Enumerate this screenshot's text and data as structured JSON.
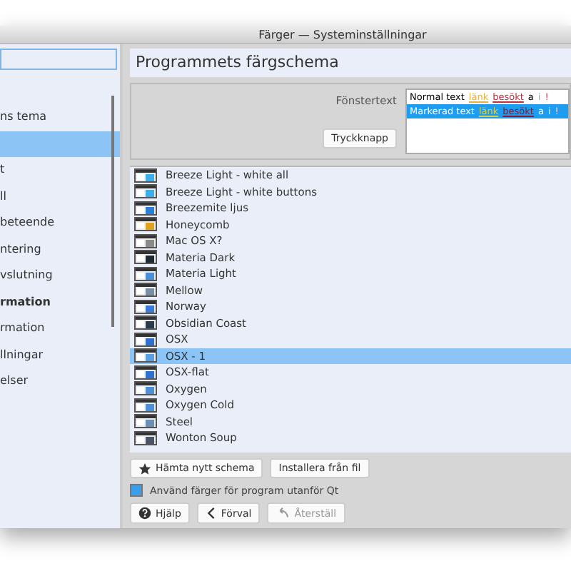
{
  "window": {
    "title": "Färger — Systeminställningar"
  },
  "sidebar": {
    "items": [
      {
        "label": "ns tema",
        "selected": false,
        "kind": "item"
      },
      {
        "selected": true,
        "kind": "item"
      },
      {
        "label": "t",
        "selected": false,
        "kind": "item"
      },
      {
        "label": "ll",
        "selected": false,
        "kind": "item"
      },
      {
        "label": "beteende",
        "selected": false,
        "kind": "item"
      },
      {
        "label": "ntering",
        "selected": false,
        "kind": "item"
      },
      {
        "label": "vslutning",
        "selected": false,
        "kind": "item"
      },
      {
        "label": "rmation",
        "kind": "header"
      },
      {
        "label": "rmation",
        "selected": false,
        "kind": "item"
      },
      {
        "label": "llningar",
        "selected": false,
        "kind": "item"
      },
      {
        "label": "elser",
        "selected": false,
        "kind": "item"
      }
    ]
  },
  "header": "Programmets färgschema",
  "preview": {
    "label": "Fönstertext",
    "button": "Tryckknapp",
    "rows": [
      {
        "selected": false,
        "parts": [
          {
            "kind": "normal",
            "text": "Normal text"
          },
          {
            "kind": "link",
            "text": "länk"
          },
          {
            "kind": "visited",
            "text": "besökt"
          },
          {
            "kind": "normal",
            "text": "a"
          },
          {
            "kind": "inactive",
            "text": "i"
          },
          {
            "kind": "alert",
            "text": "!"
          }
        ]
      },
      {
        "selected": true,
        "parts": [
          {
            "kind": "normal",
            "text": "Markerad text"
          },
          {
            "kind": "link",
            "text": "länk"
          },
          {
            "kind": "visited",
            "text": "besökt"
          },
          {
            "kind": "normal",
            "text": "a"
          },
          {
            "kind": "inactive",
            "text": "i"
          },
          {
            "kind": "alert",
            "text": "!"
          }
        ]
      }
    ]
  },
  "schemes": [
    {
      "name": "Breeze Light - white all",
      "selected": false,
      "color": "#3daee9"
    },
    {
      "name": "Breeze Light - white buttons",
      "selected": false,
      "color": "#3daee9"
    },
    {
      "name": "Breezemite ljus",
      "selected": false,
      "color": "#2c7fd6"
    },
    {
      "name": "Honeycomb",
      "selected": false,
      "color": "#e0a21c"
    },
    {
      "name": "Mac OS X?",
      "selected": false,
      "color": "#8a8a8a"
    },
    {
      "name": "Materia Dark",
      "selected": false,
      "color": "#1e2a33"
    },
    {
      "name": "Materia Light",
      "selected": false,
      "color": "#4a90d9"
    },
    {
      "name": "Mellow",
      "selected": false,
      "color": "#7a8fa6"
    },
    {
      "name": "Norway",
      "selected": false,
      "color": "#3a7bd5"
    },
    {
      "name": "Obsidian Coast",
      "selected": false,
      "color": "#2b3a4a"
    },
    {
      "name": "OSX",
      "selected": false,
      "color": "#2f6fd0"
    },
    {
      "name": "OSX - 1",
      "selected": true,
      "color": "#5aa0e0"
    },
    {
      "name": "OSX-flat",
      "selected": false,
      "color": "#2f6fd0"
    },
    {
      "name": "Oxygen",
      "selected": false,
      "color": "#4f8fd8"
    },
    {
      "name": "Oxygen Cold",
      "selected": false,
      "color": "#4f8fd8"
    },
    {
      "name": "Steel",
      "selected": false,
      "color": "#6b8fb5"
    },
    {
      "name": "Wonton Soup",
      "selected": false,
      "color": "#4a5566"
    }
  ],
  "actions": [
    "Hämta nytt schema",
    "Installera från fil"
  ],
  "apply_outside_qt": {
    "label": "Använd färger för program utanför Qt",
    "checked": true
  },
  "footer": [
    {
      "label": "Hjälp",
      "kind": "help",
      "disabled": false
    },
    {
      "label": "Förval",
      "kind": "back",
      "disabled": false
    },
    {
      "label": "Återställ",
      "kind": "undo",
      "disabled": true
    }
  ]
}
